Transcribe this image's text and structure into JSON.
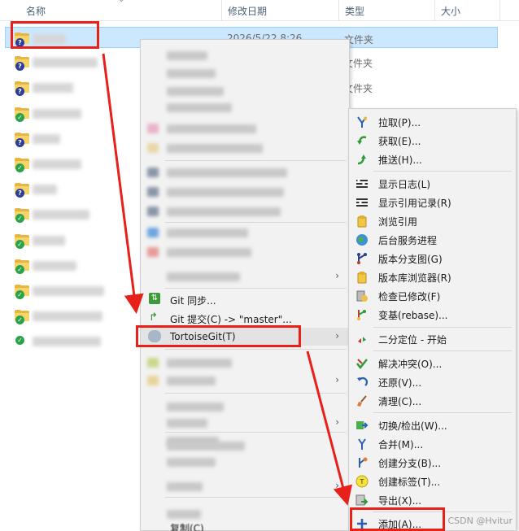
{
  "header": {
    "columns": [
      "名称",
      "修改日期",
      "类型",
      "大小"
    ]
  },
  "files": {
    "row0": {
      "overlay": "?",
      "date": "2026/5/22 8:26",
      "type": "文件夹"
    },
    "row1": {
      "overlay": "?",
      "type": "文件夹"
    },
    "row2": {
      "overlay": "?",
      "type": "文件夹"
    },
    "row3": {
      "overlay": "✓"
    },
    "row4": {
      "overlay": "?"
    },
    "row5": {
      "overlay": "✓"
    },
    "row6": {
      "overlay": "?"
    },
    "row7": {
      "overlay": "✓"
    },
    "row8": {
      "overlay": "✓"
    },
    "row9": {
      "overlay": "✓"
    },
    "row10": {
      "overlay": "✓"
    },
    "row11": {
      "overlay": "✓"
    },
    "row12": {
      "overlay": "✓"
    }
  },
  "context_menu": {
    "git_sync": "Git 同步...",
    "git_commit": "Git 提交(C) -> \"master\"...",
    "tortoisegit": "TortoiseGit(T)",
    "arrow": "›",
    "partial_bottom": "复制(C)"
  },
  "submenu": {
    "items": [
      {
        "label": "拉取(P)...",
        "icon": "pull-icon"
      },
      {
        "label": "获取(E)...",
        "icon": "fetch-icon"
      },
      {
        "label": "推送(H)...",
        "icon": "push-icon"
      },
      {
        "label": "显示日志(L)",
        "icon": "log-icon"
      },
      {
        "label": "显示引用记录(R)",
        "icon": "reflog-icon"
      },
      {
        "label": "浏览引用",
        "icon": "browse-refs-icon"
      },
      {
        "label": "后台服务进程",
        "icon": "daemon-icon"
      },
      {
        "label": "版本分支图(G)",
        "icon": "revision-graph-icon"
      },
      {
        "label": "版本库浏览器(R)",
        "icon": "repo-browser-icon"
      },
      {
        "label": "检查已修改(F)",
        "icon": "check-modifications-icon"
      },
      {
        "label": "变基(rebase)...",
        "icon": "rebase-icon"
      },
      {
        "label": "二分定位 - 开始",
        "icon": "bisect-icon"
      },
      {
        "label": "解决冲突(O)...",
        "icon": "resolve-icon"
      },
      {
        "label": "还原(V)...",
        "icon": "revert-icon"
      },
      {
        "label": "清理(C)...",
        "icon": "cleanup-icon"
      },
      {
        "label": "切换/检出(W)...",
        "icon": "switch-checkout-icon"
      },
      {
        "label": "合并(M)...",
        "icon": "merge-icon"
      },
      {
        "label": "创建分支(B)...",
        "icon": "branch-icon"
      },
      {
        "label": "创建标签(T)...",
        "icon": "tag-icon"
      },
      {
        "label": "导出(X)...",
        "icon": "export-icon"
      },
      {
        "label": "添加(A)...",
        "icon": "add-icon"
      }
    ]
  },
  "colors": {
    "annotation_red": "#e8201a",
    "selection": "#cce8ff",
    "menu_bg": "#f2f2f2"
  },
  "watermark": "CSDN @Hvitur"
}
